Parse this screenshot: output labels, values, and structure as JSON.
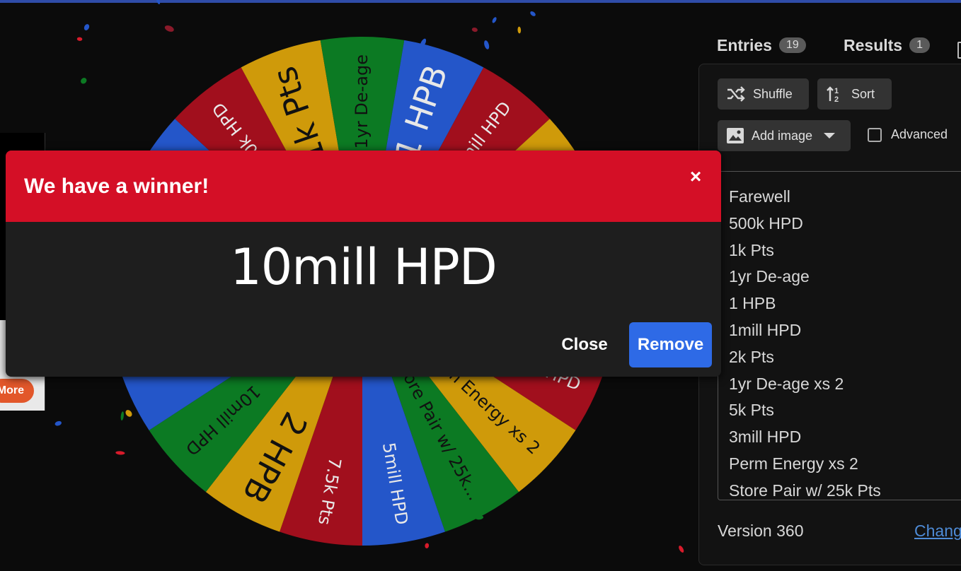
{
  "wheel": {
    "slices": [
      {
        "label": "Farewell",
        "color": "#2456c9"
      },
      {
        "label": "500k HPD",
        "color": "#a10f1d"
      },
      {
        "label": "1k Pts",
        "color": "#cf9a0a"
      },
      {
        "label": "1yr De-age",
        "color": "#0c7a23"
      },
      {
        "label": "1 HPB",
        "color": "#2456c9"
      },
      {
        "label": "1mill HPD",
        "color": "#a10f1d"
      },
      {
        "label": "2k Pts",
        "color": "#cf9a0a"
      },
      {
        "label": "1yr De-age xs 2",
        "color": "#0c7a23"
      },
      {
        "label": "5k Pts",
        "color": "#2456c9"
      },
      {
        "label": "3mill HPD",
        "color": "#a10f1d"
      },
      {
        "label": "Perm Energy xs 2",
        "color": "#cf9a0a"
      },
      {
        "label": "Store Pair w/ 25k...",
        "color": "#0c7a23"
      },
      {
        "label": "5mill HPD",
        "color": "#2456c9"
      },
      {
        "label": "7.5k Pts",
        "color": "#a10f1d"
      },
      {
        "label": "2 HPB",
        "color": "#cf9a0a"
      },
      {
        "label": "10mill HPD",
        "color": "#0c7a23"
      },
      {
        "label": "",
        "color": "#2456c9"
      },
      {
        "label": "",
        "color": "#a10f1d"
      },
      {
        "label": "",
        "color": "#cf9a0a"
      }
    ]
  },
  "left_panel": {
    "more_label": "More"
  },
  "tabs": {
    "entries_label": "Entries",
    "entries_count": "19",
    "results_label": "Results",
    "results_count": "1"
  },
  "toolbar": {
    "shuffle_label": "Shuffle",
    "sort_label": "Sort",
    "add_image_label": "Add image",
    "advanced_label": "Advanced"
  },
  "entries": [
    "Farewell",
    "500k HPD",
    "1k Pts",
    "1yr De-age",
    "1 HPB",
    "1mill HPD",
    "2k Pts",
    "1yr De-age xs 2",
    "5k Pts",
    "3mill HPD",
    "Perm Energy xs 2",
    "Store Pair w/ 25k Pts"
  ],
  "footer": {
    "version": "Version 360",
    "changelog_label": "Chang"
  },
  "dialog": {
    "title": "We have a winner!",
    "close_x": "×",
    "winner": "10mill HPD",
    "close_label": "Close",
    "remove_label": "Remove"
  },
  "colors": {
    "dialog_header": "#d40f26",
    "remove_button": "#2e6ae6",
    "wheel_blue": "#2456c9",
    "wheel_red": "#a10f1d",
    "wheel_yellow": "#cf9a0a",
    "wheel_green": "#0c7a23"
  }
}
